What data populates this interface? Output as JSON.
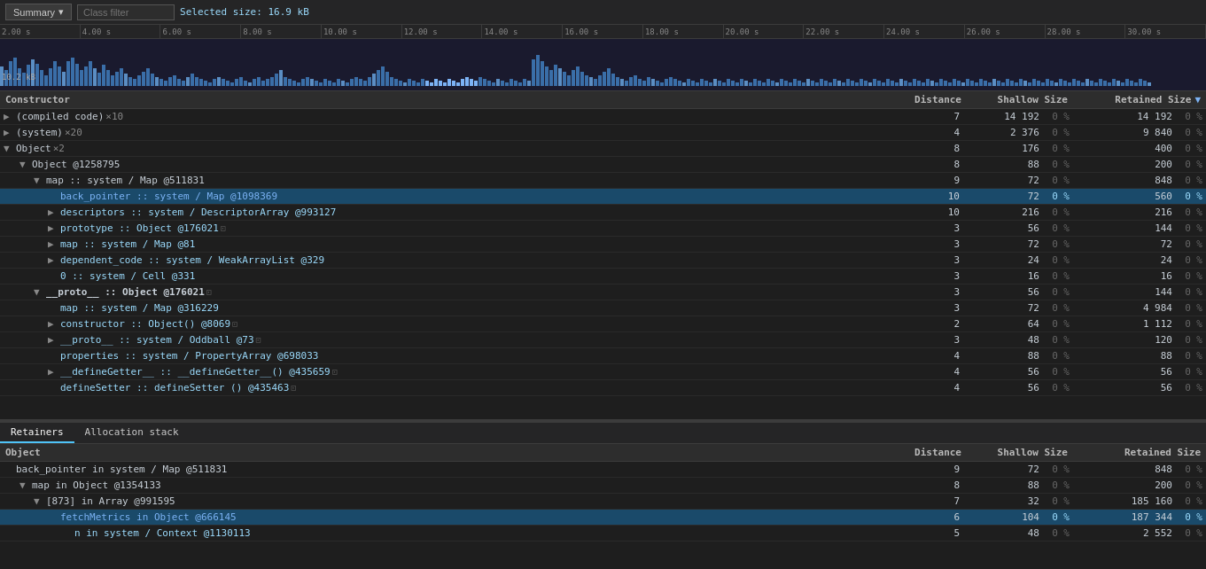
{
  "topbar": {
    "summary_label": "Summary",
    "dropdown_icon": "▾",
    "class_filter_placeholder": "Class filter",
    "selected_size": "Selected size: 16.9 kB"
  },
  "timeline": {
    "size_label": "10.2 kB",
    "ticks": [
      "2.00 s",
      "4.00 s",
      "6.00 s",
      "8.00 s",
      "10.00 s",
      "12.00 s",
      "14.00 s",
      "16.00 s",
      "18.00 s",
      "20.00 s",
      "22.00 s",
      "24.00 s",
      "26.00 s",
      "28.00 s",
      "30.00 s"
    ]
  },
  "main_table": {
    "headers": {
      "constructor": "Constructor",
      "distance": "Distance",
      "shallow_size": "Shallow Size",
      "retained_size": "Retained Size",
      "sort_indicator": "▼"
    },
    "rows": [
      {
        "indent": 0,
        "expand": true,
        "expanded": false,
        "name": "(compiled code)",
        "suffix": " ×10",
        "bold": false,
        "distance": "7",
        "shallow": "14 192",
        "shallow_pct": "0 %",
        "retained": "14 192",
        "retained_pct": "0 %"
      },
      {
        "indent": 0,
        "expand": true,
        "expanded": false,
        "name": "(system)",
        "suffix": " ×20",
        "bold": false,
        "distance": "4",
        "shallow": "2 376",
        "shallow_pct": "0 %",
        "retained": "9 840",
        "retained_pct": "0 %"
      },
      {
        "indent": 0,
        "expand": true,
        "expanded": true,
        "name": "Object",
        "suffix": " ×2",
        "bold": false,
        "distance": "8",
        "shallow": "176",
        "shallow_pct": "0 %",
        "retained": "400",
        "retained_pct": "0 %"
      },
      {
        "indent": 1,
        "expand": true,
        "expanded": true,
        "name": "Object @1258795",
        "suffix": "",
        "bold": false,
        "distance": "8",
        "shallow": "88",
        "shallow_pct": "0 %",
        "retained": "200",
        "retained_pct": "0 %"
      },
      {
        "indent": 2,
        "expand": true,
        "expanded": true,
        "name": "map :: system / Map @511831",
        "suffix": "",
        "bold": false,
        "distance": "9",
        "shallow": "72",
        "shallow_pct": "0 %",
        "retained": "848",
        "retained_pct": "0 %"
      },
      {
        "indent": 3,
        "expand": false,
        "expanded": false,
        "name": "back_pointer :: system / Map @1098369",
        "suffix": "",
        "bold": false,
        "distance": "10",
        "shallow": "72",
        "shallow_pct": "0 %",
        "retained": "560",
        "retained_pct": "0 %",
        "selected": true
      },
      {
        "indent": 3,
        "expand": true,
        "expanded": false,
        "name": "descriptors :: system / DescriptorArray @993127",
        "suffix": "",
        "bold": false,
        "distance": "10",
        "shallow": "216",
        "shallow_pct": "0 %",
        "retained": "216",
        "retained_pct": "0 %"
      },
      {
        "indent": 3,
        "expand": true,
        "expanded": false,
        "name": "prototype :: Object @176021",
        "suffix": "",
        "copy": true,
        "bold": false,
        "distance": "3",
        "shallow": "56",
        "shallow_pct": "0 %",
        "retained": "144",
        "retained_pct": "0 %"
      },
      {
        "indent": 3,
        "expand": true,
        "expanded": false,
        "name": "map :: system / Map @81",
        "suffix": "",
        "bold": false,
        "distance": "3",
        "shallow": "72",
        "shallow_pct": "0 %",
        "retained": "72",
        "retained_pct": "0 %"
      },
      {
        "indent": 3,
        "expand": true,
        "expanded": false,
        "name": "dependent_code :: system / WeakArrayList @329",
        "suffix": "",
        "bold": false,
        "distance": "3",
        "shallow": "24",
        "shallow_pct": "0 %",
        "retained": "24",
        "retained_pct": "0 %"
      },
      {
        "indent": 3,
        "expand": false,
        "expanded": false,
        "name": "0 :: system / Cell @331",
        "suffix": "",
        "bold": false,
        "distance": "3",
        "shallow": "16",
        "shallow_pct": "0 %",
        "retained": "16",
        "retained_pct": "0 %"
      },
      {
        "indent": 2,
        "expand": true,
        "expanded": true,
        "name": "__proto__ :: Object @176021",
        "suffix": "",
        "copy": true,
        "bold": true,
        "distance": "3",
        "shallow": "56",
        "shallow_pct": "0 %",
        "retained": "144",
        "retained_pct": "0 %"
      },
      {
        "indent": 3,
        "expand": false,
        "expanded": false,
        "name": "map :: system / Map @316229",
        "suffix": "",
        "bold": false,
        "distance": "3",
        "shallow": "72",
        "shallow_pct": "0 %",
        "retained": "4 984",
        "retained_pct": "0 %"
      },
      {
        "indent": 3,
        "expand": true,
        "expanded": false,
        "name": "constructor :: Object() @8069",
        "suffix": "",
        "copy": true,
        "bold": false,
        "distance": "2",
        "shallow": "64",
        "shallow_pct": "0 %",
        "retained": "1 112",
        "retained_pct": "0 %"
      },
      {
        "indent": 3,
        "expand": true,
        "expanded": false,
        "name": "__proto__ :: system / Oddball @73",
        "suffix": "",
        "copy": true,
        "bold": false,
        "distance": "3",
        "shallow": "48",
        "shallow_pct": "0 %",
        "retained": "120",
        "retained_pct": "0 %"
      },
      {
        "indent": 3,
        "expand": false,
        "expanded": false,
        "name": "properties :: system / PropertyArray @698033",
        "suffix": "",
        "bold": false,
        "distance": "4",
        "shallow": "88",
        "shallow_pct": "0 %",
        "retained": "88",
        "retained_pct": "0 %"
      },
      {
        "indent": 3,
        "expand": true,
        "expanded": false,
        "name": "__defineGetter__ :: __defineGetter__() @435659",
        "suffix": "",
        "copy": true,
        "bold": false,
        "distance": "4",
        "shallow": "56",
        "shallow_pct": "0 %",
        "retained": "56",
        "retained_pct": "0 %"
      },
      {
        "indent": 3,
        "expand": false,
        "expanded": false,
        "name": "defineSetter :: defineSetter () @435463",
        "suffix": "",
        "copy": true,
        "bold": false,
        "distance": "4",
        "shallow": "56",
        "shallow_pct": "0 %",
        "retained": "56",
        "retained_pct": "0 %"
      }
    ]
  },
  "bottom_tabs": [
    {
      "label": "Retainers",
      "active": true
    },
    {
      "label": "Allocation stack",
      "active": false
    }
  ],
  "bottom_table": {
    "headers": {
      "constructor": "Object",
      "distance": "Distance",
      "shallow_size": "Shallow Size",
      "retained_size": "Retained Size"
    },
    "rows": [
      {
        "indent": 0,
        "expand": false,
        "expanded": false,
        "name": "back_pointer in system / Map @511831",
        "suffix": "",
        "bold": false,
        "distance": "9",
        "shallow": "72",
        "shallow_pct": "0 %",
        "retained": "848",
        "retained_pct": "0 %"
      },
      {
        "indent": 1,
        "expand": true,
        "expanded": true,
        "name": "map in Object @1354133",
        "suffix": "",
        "bold": false,
        "distance": "8",
        "shallow": "88",
        "shallow_pct": "0 %",
        "retained": "200",
        "retained_pct": "0 %"
      },
      {
        "indent": 2,
        "expand": true,
        "expanded": true,
        "name": "[873] in Array @991595",
        "suffix": "",
        "bold": false,
        "distance": "7",
        "shallow": "32",
        "shallow_pct": "0 %",
        "retained": "185 160",
        "retained_pct": "0 %"
      },
      {
        "indent": 3,
        "expand": false,
        "expanded": false,
        "name": "fetchMetrics in Object @666145",
        "suffix": "",
        "bold": false,
        "distance": "6",
        "shallow": "104",
        "shallow_pct": "0 %",
        "retained": "187 344",
        "retained_pct": "0 %",
        "selected": true
      },
      {
        "indent": 4,
        "expand": false,
        "expanded": false,
        "name": "n in system / Context @1130113",
        "suffix": "",
        "bold": false,
        "distance": "5",
        "shallow": "48",
        "shallow_pct": "0 %",
        "retained": "2 552",
        "retained_pct": "0 %"
      }
    ]
  }
}
